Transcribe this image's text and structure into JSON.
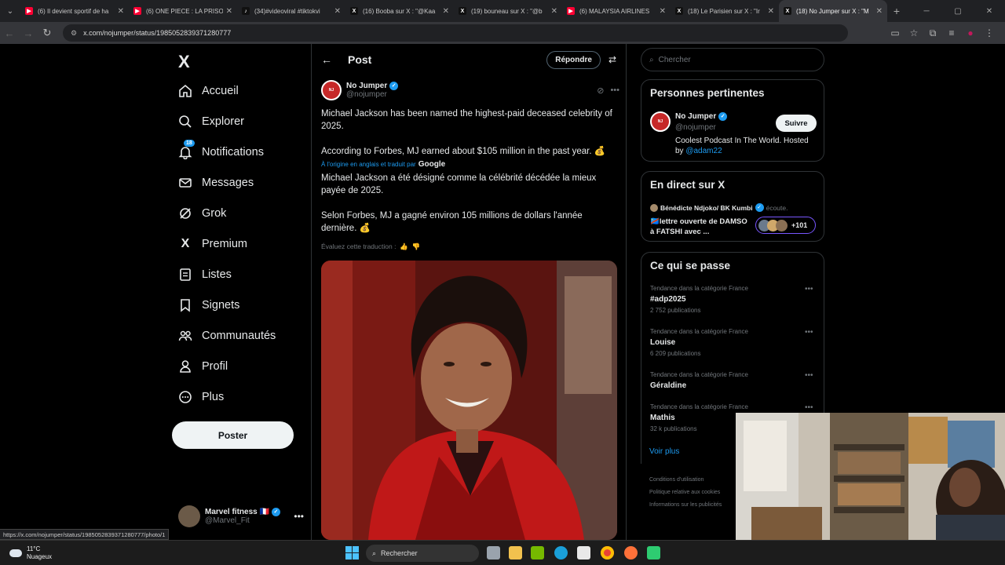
{
  "browser": {
    "tabs": [
      {
        "title": "(6) Il devient sportif de ha",
        "icon": "youtube-icon",
        "color": "#ff0033"
      },
      {
        "title": "(6) ONE PIECE : LA PRISO",
        "icon": "youtube-icon",
        "color": "#ff0033"
      },
      {
        "title": "(34)#videoviral #tiktokvi",
        "icon": "tiktok-icon",
        "color": "#111111"
      },
      {
        "title": "(16) Booba sur X : \"@Kaa",
        "icon": "x-icon",
        "color": "#111111"
      },
      {
        "title": "(19) bouneau sur X : \"@b",
        "icon": "x-icon",
        "color": "#111111"
      },
      {
        "title": "(6) MALAYSIA AIRLINES",
        "icon": "youtube-icon",
        "color": "#ff0033"
      },
      {
        "title": "(18) Le Parisien sur X : \"Ir",
        "icon": "x-icon",
        "color": "#111111"
      },
      {
        "title": "(18) No Jumper sur X : \"M",
        "icon": "x-icon",
        "color": "#111111",
        "active": true
      }
    ],
    "url": "x.com/nojumper/status/1985052839371280777",
    "status_url": "https://x.com/nojumper/status/1985052839371280777/photo/1"
  },
  "sidebar": {
    "logo": "X",
    "items": [
      {
        "label": "Accueil",
        "icon": "home-icon"
      },
      {
        "label": "Explorer",
        "icon": "search-icon"
      },
      {
        "label": "Notifications",
        "icon": "bell-icon",
        "badge": "18"
      },
      {
        "label": "Messages",
        "icon": "envelope-icon"
      },
      {
        "label": "Grok",
        "icon": "grok-icon"
      },
      {
        "label": "Premium",
        "icon": "x-premium-icon"
      },
      {
        "label": "Listes",
        "icon": "list-icon"
      },
      {
        "label": "Signets",
        "icon": "bookmark-icon"
      },
      {
        "label": "Communautés",
        "icon": "community-icon"
      },
      {
        "label": "Profil",
        "icon": "person-icon"
      },
      {
        "label": "Plus",
        "icon": "more-circle-icon"
      }
    ],
    "post_button": "Poster",
    "account": {
      "name": "Marvel fitness",
      "flag": "🇫🇷",
      "handle": "@Marvel_Fit"
    }
  },
  "main": {
    "header_title": "Post",
    "reply_button": "Répondre",
    "post": {
      "author_name": "No Jumper",
      "author_handle": "@nojumper",
      "text1": "Michael Jackson has been named the highest-paid deceased celebrity of 2025.",
      "text2": "According to Forbes, MJ earned about $105 million in the past year. 💰",
      "translated_label": "À l'origine en anglais et traduit par",
      "translator": "Google",
      "trans1": "Michael Jackson a été désigné comme la célébrité décédée la mieux payée de 2025.",
      "trans2": "Selon Forbes, MJ a gagné environ 105 millions de dollars l'année dernière. 💰",
      "rate_translation": "Évaluez cette traduction :"
    }
  },
  "right": {
    "search_placeholder": "Chercher",
    "relevant": {
      "title": "Personnes pertinentes",
      "name": "No Jumper",
      "handle": "@nojumper",
      "follow": "Suivre",
      "bio": "Coolest Podcast In The World. Hosted by",
      "bio_link": "@adam22"
    },
    "live": {
      "title": "En direct sur X",
      "host": "Bénédicte Ndjoko/ BK Kumbi",
      "listening": "écoute.",
      "space_title": "🇨🇩lettre ouverte de DAMSO à FATSHI avec ...",
      "count": "+101"
    },
    "trends": {
      "title": "Ce qui se passe",
      "items": [
        {
          "category": "Tendance dans la catégorie France",
          "name": "#adp2025",
          "count": "2 752 publications"
        },
        {
          "category": "Tendance dans la catégorie France",
          "name": "Louise",
          "count": "6 209 publications"
        },
        {
          "category": "Tendance dans la catégorie France",
          "name": "Géraldine",
          "count": ""
        },
        {
          "category": "Tendance dans la catégorie France",
          "name": "Mathis",
          "count": "32 k publications"
        }
      ],
      "more": "Voir plus"
    },
    "footer": [
      "Conditions d'utilisation",
      "Politique relative aux cookies",
      "Informations sur les publicités"
    ]
  },
  "taskbar": {
    "temp": "11°C",
    "weather": "Nuageux",
    "search": "Rechercher"
  }
}
